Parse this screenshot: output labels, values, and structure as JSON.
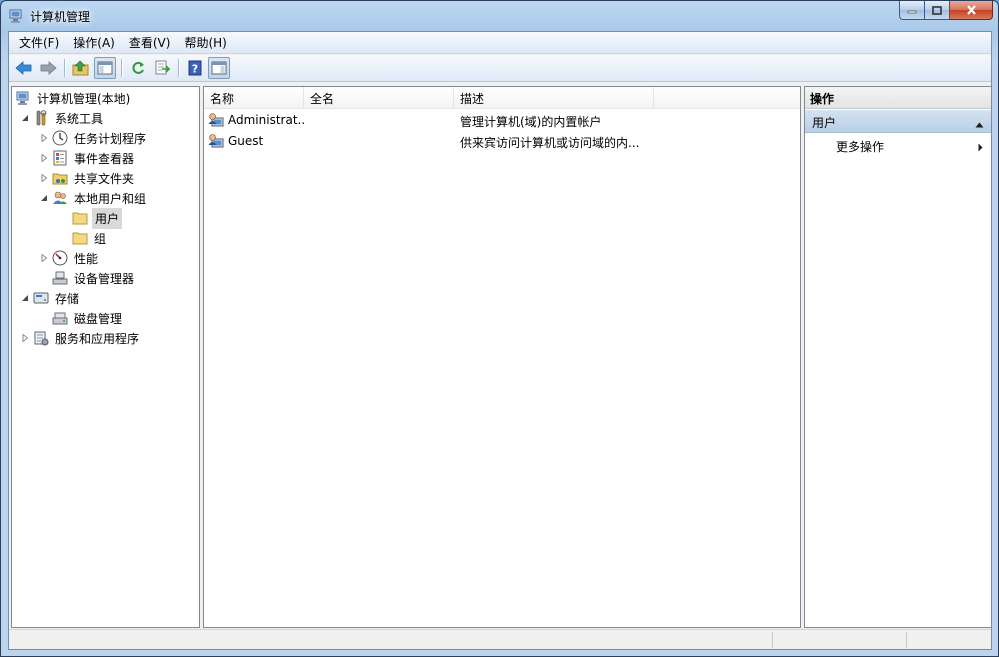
{
  "window": {
    "title": "计算机管理"
  },
  "menu": {
    "items": [
      "文件(F)",
      "操作(A)",
      "查看(V)",
      "帮助(H)"
    ]
  },
  "toolbar": {
    "buttons": [
      "back-arrow-icon",
      "forward-arrow-icon",
      "up-folder-icon",
      "show-hide-tree-icon",
      "refresh-icon",
      "export-list-icon",
      "help-icon",
      "show-hide-action-pane-icon"
    ]
  },
  "tree": {
    "root": "计算机管理(本地)",
    "system_tools": "系统工具",
    "task_scheduler": "任务计划程序",
    "event_viewer": "事件查看器",
    "shared_folders": "共享文件夹",
    "local_users_groups": "本地用户和组",
    "users": "用户",
    "groups": "组",
    "performance": "性能",
    "device_manager": "设备管理器",
    "storage": "存储",
    "disk_management": "磁盘管理",
    "services_apps": "服务和应用程序"
  },
  "list": {
    "columns": [
      "名称",
      "全名",
      "描述"
    ],
    "rows": [
      {
        "name": "Administrat...",
        "fullname": "",
        "description": "管理计算机(域)的内置帐户"
      },
      {
        "name": "Guest",
        "fullname": "",
        "description": "供来宾访问计算机或访问域的内..."
      }
    ]
  },
  "actions": {
    "header": "操作",
    "section": "用户",
    "more": "更多操作"
  },
  "colors": {
    "title_bar": "#a9c9ea",
    "selection": "#d9d9d9",
    "action_section": "#b9cfe7"
  }
}
